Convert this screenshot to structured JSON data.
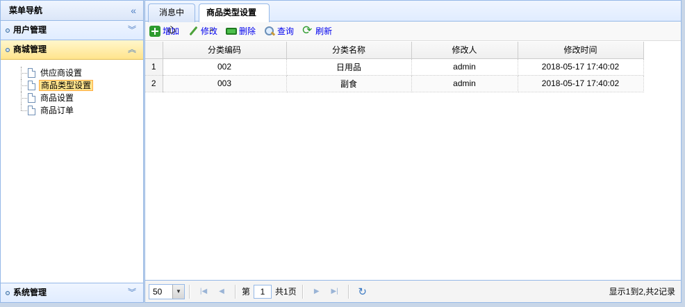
{
  "sidebar": {
    "title": "菜单导航",
    "collapse_glyph": "«",
    "sections": [
      {
        "label": "用户管理",
        "chevron": "︾"
      },
      {
        "label": "商城管理",
        "chevron": "︽"
      }
    ],
    "tree_items": [
      {
        "label": "供应商设置"
      },
      {
        "label": "商品类型设置"
      },
      {
        "label": "商品设置"
      },
      {
        "label": "商品订单"
      }
    ],
    "bottom_section": {
      "label": "系统管理",
      "chevron": "︾"
    }
  },
  "tabs": [
    {
      "label": "消息中心"
    },
    {
      "label": "商品类型设置",
      "close": "×"
    }
  ],
  "toolbar": {
    "add": "增加",
    "edit": "修改",
    "delete": "删除",
    "search": "查询",
    "refresh": "刷新"
  },
  "grid": {
    "columns": [
      "分类编码",
      "分类名称",
      "修改人",
      "修改时间"
    ],
    "rows": [
      {
        "num": "1",
        "cells": [
          "002",
          "日用品",
          "admin",
          "2018-05-17 17:40:02"
        ]
      },
      {
        "num": "2",
        "cells": [
          "003",
          "副食",
          "admin",
          "2018-05-17 17:40:02"
        ]
      }
    ]
  },
  "pager": {
    "page_size": "50",
    "page_prefix": "第",
    "page_value": "1",
    "page_total": "共1页",
    "info": "显示1到2,共2记录"
  },
  "colors": {
    "border": "#95b8e7",
    "active_section": "#ffe48d",
    "link": "#0000ee"
  }
}
